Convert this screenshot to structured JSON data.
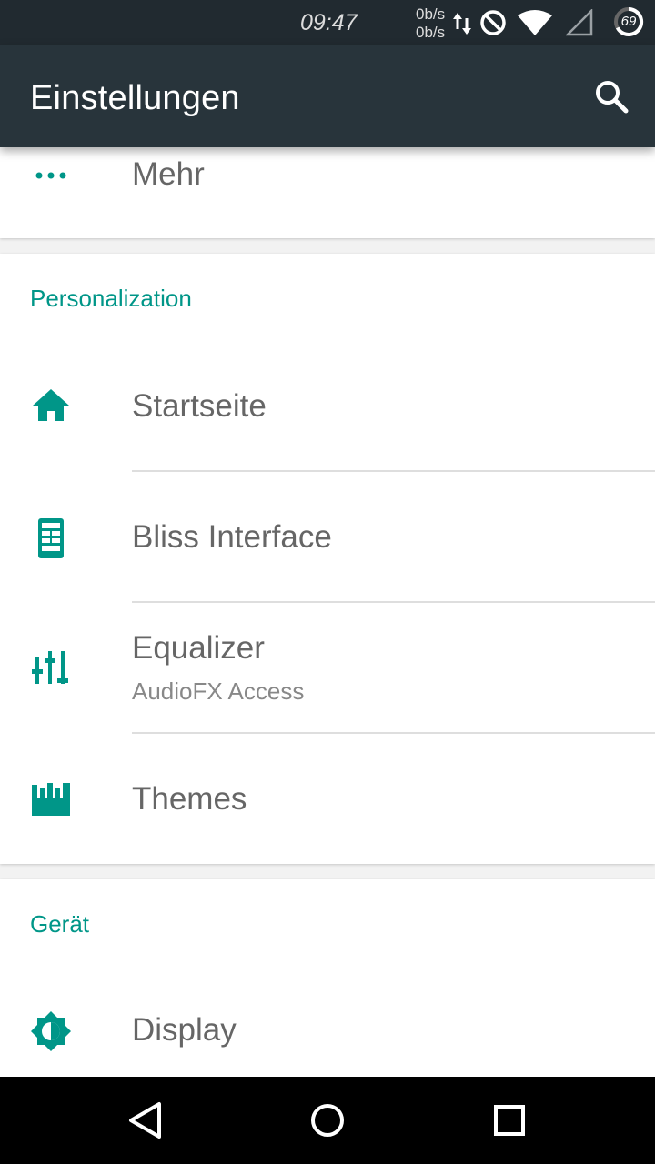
{
  "status_bar": {
    "time": "09:47",
    "net_up": "0b/s",
    "net_down": "0b/s",
    "battery_level": "69",
    "icons": [
      "data-arrows-icon",
      "do-not-disturb-icon",
      "wifi-icon",
      "signal-icon",
      "battery-icon"
    ]
  },
  "app_bar": {
    "title": "Einstellungen",
    "search_icon": "search-icon"
  },
  "top_item": {
    "label": "Mehr",
    "icon": "more-dots-icon"
  },
  "personalization": {
    "header": "Personalization",
    "items": [
      {
        "label": "Startseite",
        "icon": "home-icon"
      },
      {
        "label": "Bliss Interface",
        "icon": "bliss-interface-icon"
      },
      {
        "label": "Equalizer",
        "sublabel": "AudioFX Access",
        "icon": "equalizer-icon"
      },
      {
        "label": "Themes",
        "icon": "themes-icon"
      }
    ]
  },
  "device": {
    "header": "Gerät",
    "items": [
      {
        "label": "Display",
        "icon": "display-brightness-icon"
      }
    ]
  },
  "nav_bar": {
    "buttons": [
      "back-icon",
      "home-circle-icon",
      "recents-icon"
    ]
  },
  "colors": {
    "accent": "#009688",
    "app_bar": "#28343b",
    "status_bar": "#212a30"
  }
}
